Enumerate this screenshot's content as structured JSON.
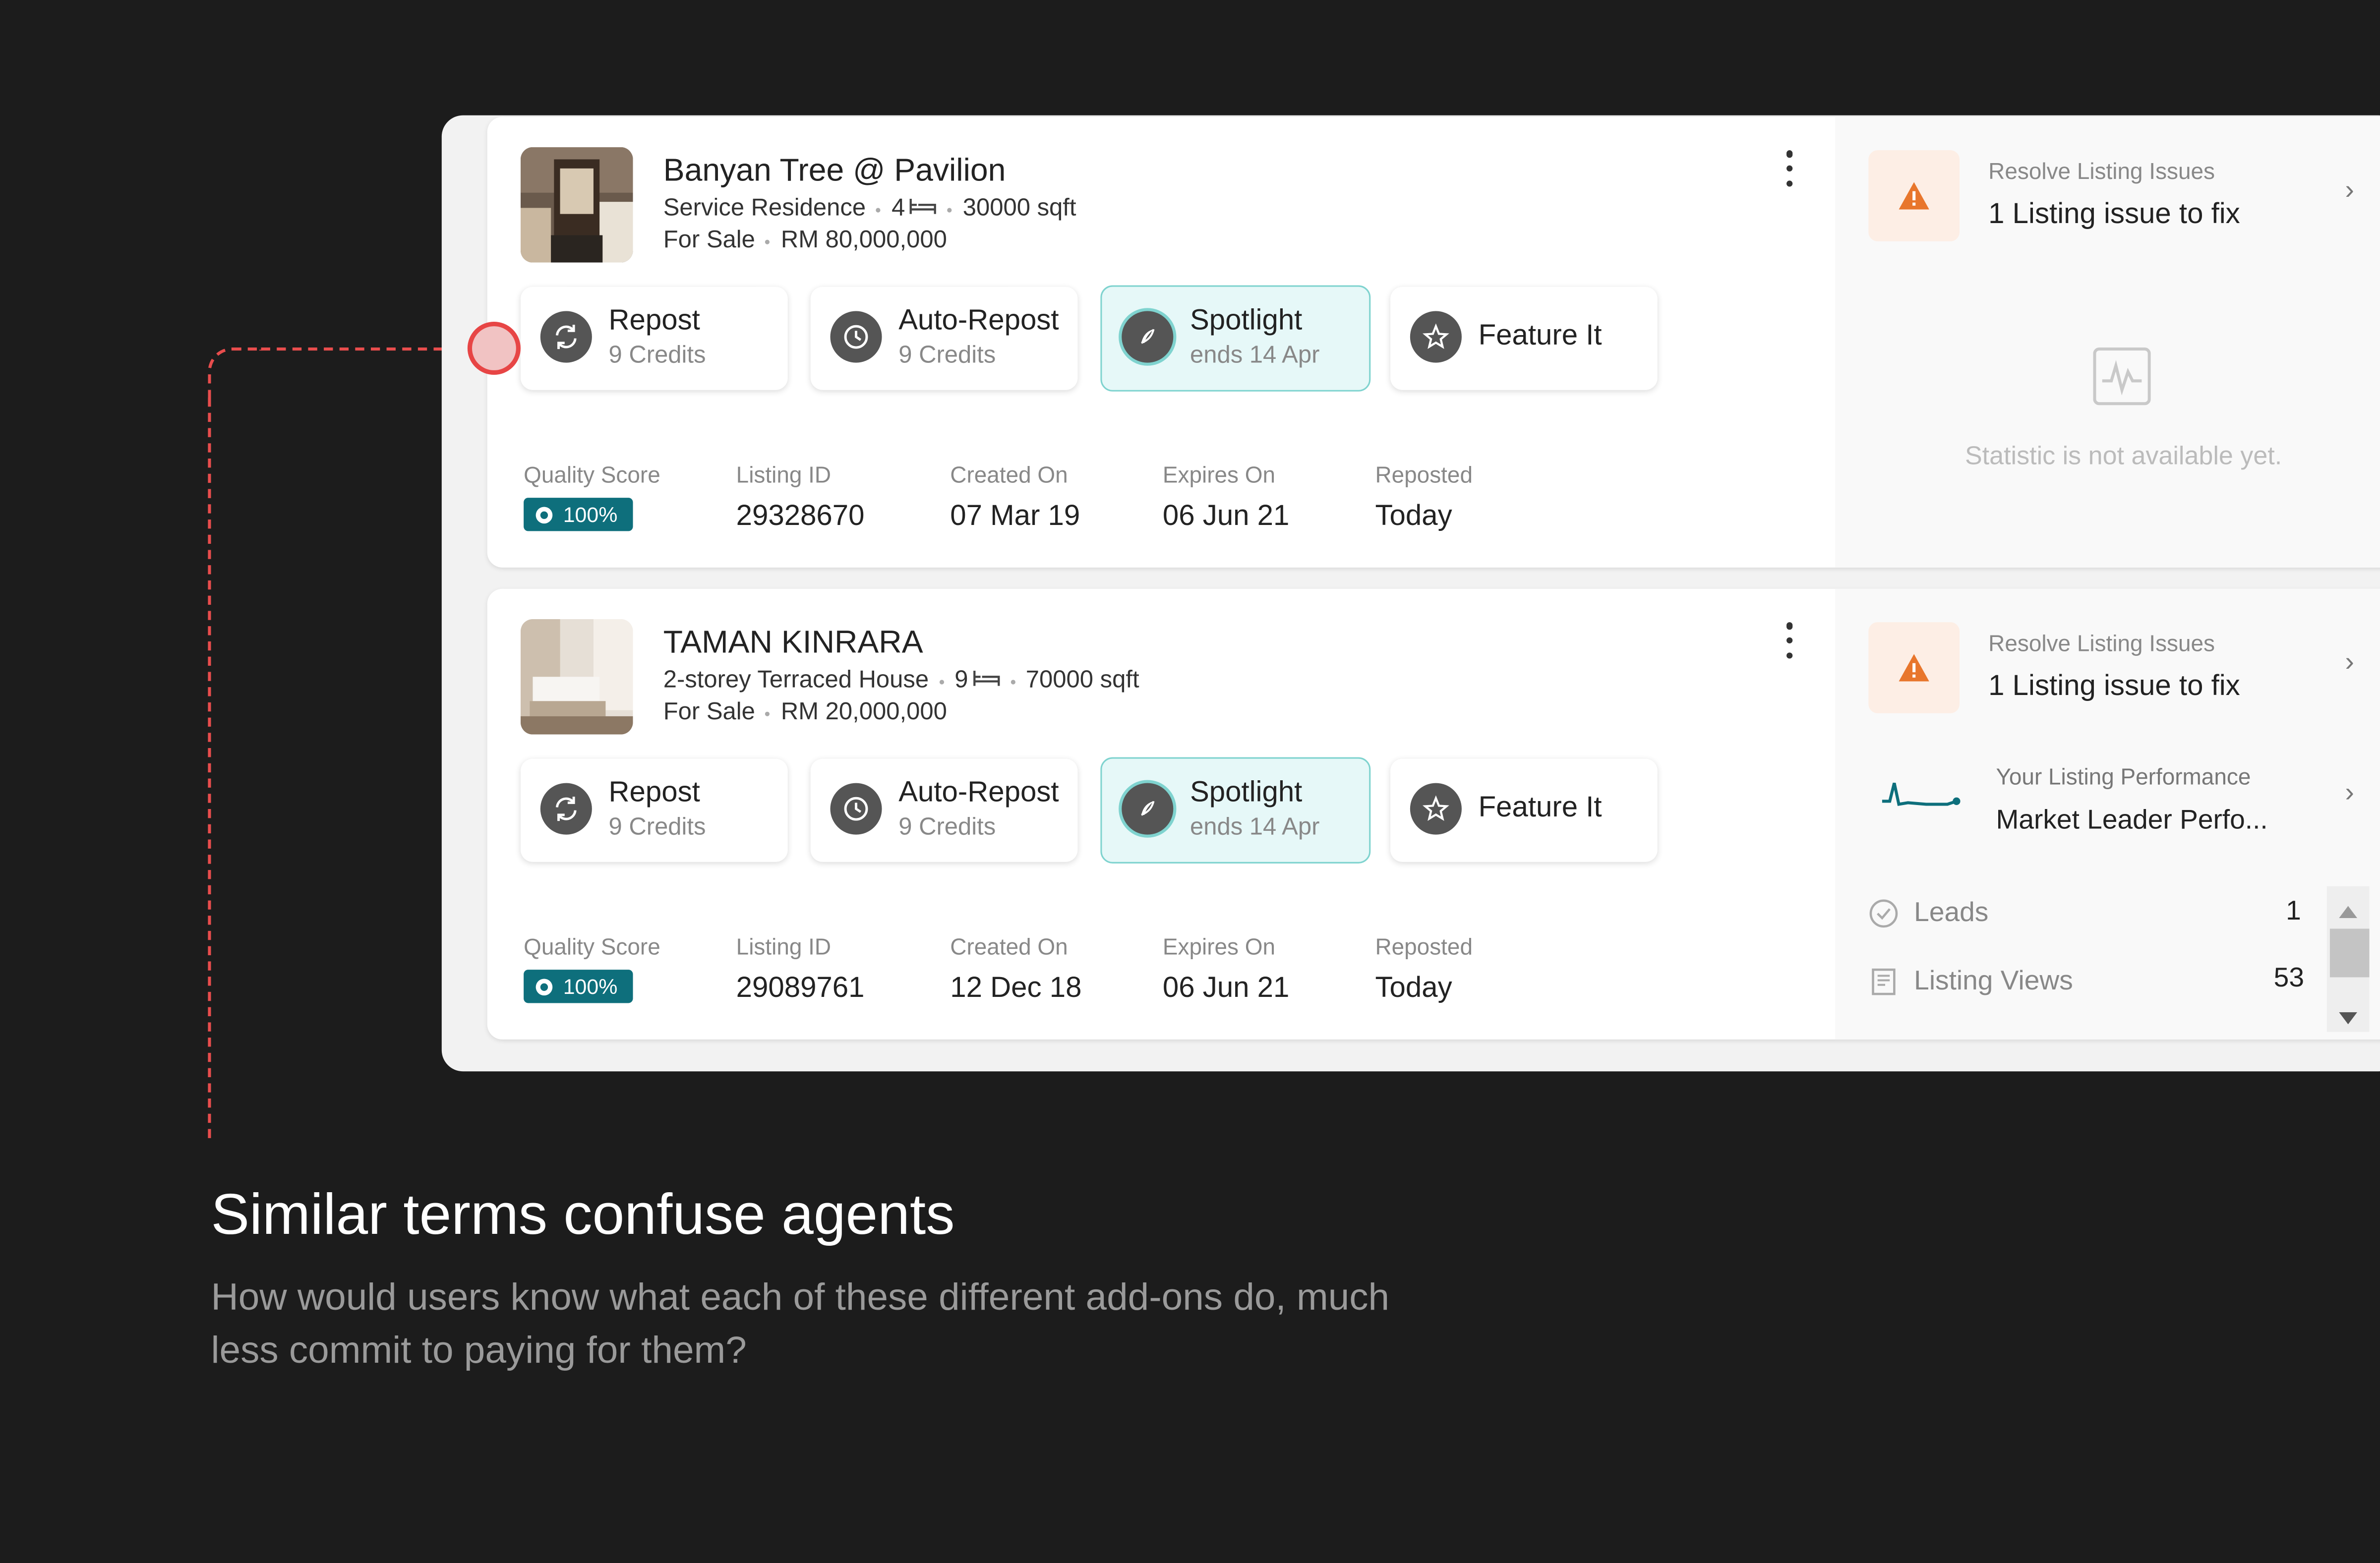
{
  "listings": [
    {
      "title": "Banyan Tree @ Pavilion",
      "property_type": "Service Residence",
      "bedrooms": "4",
      "size": "30000 sqft",
      "status": "For Sale",
      "price": "RM 80,000,000",
      "actions": {
        "repost": {
          "label": "Repost",
          "sub": "9 Credits",
          "icon": "refresh-icon"
        },
        "auto_repost": {
          "label": "Auto-Repost",
          "sub": "9 Credits",
          "icon": "clock-icon"
        },
        "spotlight": {
          "label": "Spotlight",
          "sub": "ends 14 Apr",
          "icon": "rocket-icon"
        },
        "feature": {
          "label": "Feature It",
          "icon": "star-icon"
        }
      },
      "stats": {
        "quality_label": "Quality Score",
        "quality_value": "100%",
        "id_label": "Listing ID",
        "id_value": "29328670",
        "created_label": "Created On",
        "created_value": "07 Mar 19",
        "expires_label": "Expires On",
        "expires_value": "06 Jun 21",
        "reposted_label": "Reposted",
        "reposted_value": "Today"
      },
      "side": {
        "issues_title": "Resolve Listing Issues",
        "issues_text": "1 Listing issue to fix",
        "no_stat_text": "Statistic is not available yet."
      }
    },
    {
      "title": "TAMAN KINRARA",
      "property_type": "2-storey Terraced House",
      "bedrooms": "9",
      "size": "70000 sqft",
      "status": "For Sale",
      "price": "RM 20,000,000",
      "actions": {
        "repost": {
          "label": "Repost",
          "sub": "9 Credits",
          "icon": "refresh-icon"
        },
        "auto_repost": {
          "label": "Auto-Repost",
          "sub": "9 Credits",
          "icon": "clock-icon"
        },
        "spotlight": {
          "label": "Spotlight",
          "sub": "ends 14 Apr",
          "icon": "rocket-icon"
        },
        "feature": {
          "label": "Feature It",
          "icon": "star-icon"
        }
      },
      "stats": {
        "quality_label": "Quality Score",
        "quality_value": "100%",
        "id_label": "Listing ID",
        "id_value": "29089761",
        "created_label": "Created On",
        "created_value": "12 Dec 18",
        "expires_label": "Expires On",
        "expires_value": "06 Jun 21",
        "reposted_label": "Reposted",
        "reposted_value": "Today"
      },
      "side": {
        "issues_title": "Resolve Listing Issues",
        "issues_text": "1 Listing issue to fix",
        "perf_title": "Your Listing Performance",
        "perf_text": "Market Leader Perfo...",
        "leads_label": "Leads",
        "leads_value": "1",
        "views_label": "Listing Views",
        "views_value": "53"
      }
    }
  ],
  "annotation": {
    "headline": "Similar terms confuse agents",
    "body": "How would users know what each of these different add-ons do, much less commit to paying for them?"
  },
  "colors": {
    "background": "#1c1c1c",
    "accent_teal": "#0e6f7c",
    "spotlight_bg": "#e6f8f8",
    "warning_orange": "#e8762c",
    "annotation_red": "#e84d4d"
  }
}
